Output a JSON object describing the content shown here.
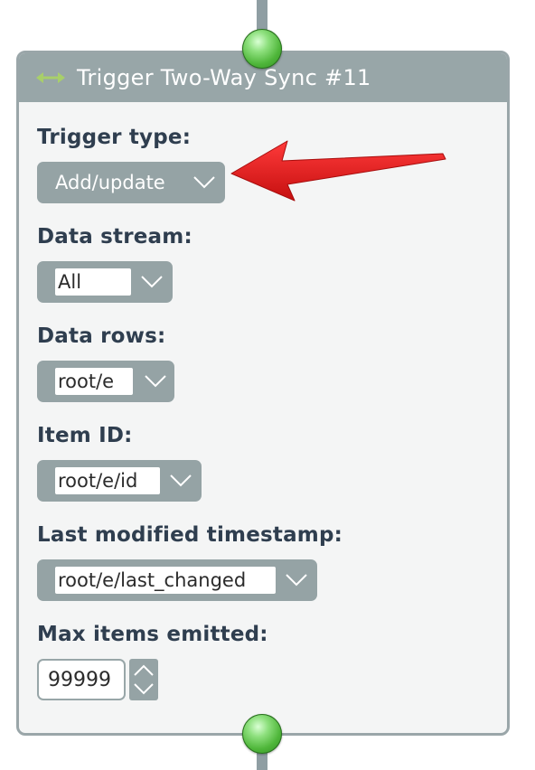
{
  "panel": {
    "title": "Trigger Two-Way Sync #11",
    "icon": "two-way-arrow-icon"
  },
  "fields": {
    "trigger_type": {
      "label": "Trigger type:",
      "value": "Add/update"
    },
    "data_stream": {
      "label": "Data stream:",
      "value": "All"
    },
    "data_rows": {
      "label": "Data rows:",
      "value": "root/e"
    },
    "item_id": {
      "label": "Item ID:",
      "value": "root/e/id"
    },
    "last_modified": {
      "label": "Last modified timestamp:",
      "value": "root/e/last_changed"
    },
    "max_items": {
      "label": "Max items emitted:",
      "value": "99999"
    }
  },
  "colors": {
    "header": "#98a6a8",
    "control": "#95a3a5",
    "label_text": "#2f3e4f",
    "node_green": "#4fb63a",
    "annotation_arrow": "#e21b1b"
  }
}
